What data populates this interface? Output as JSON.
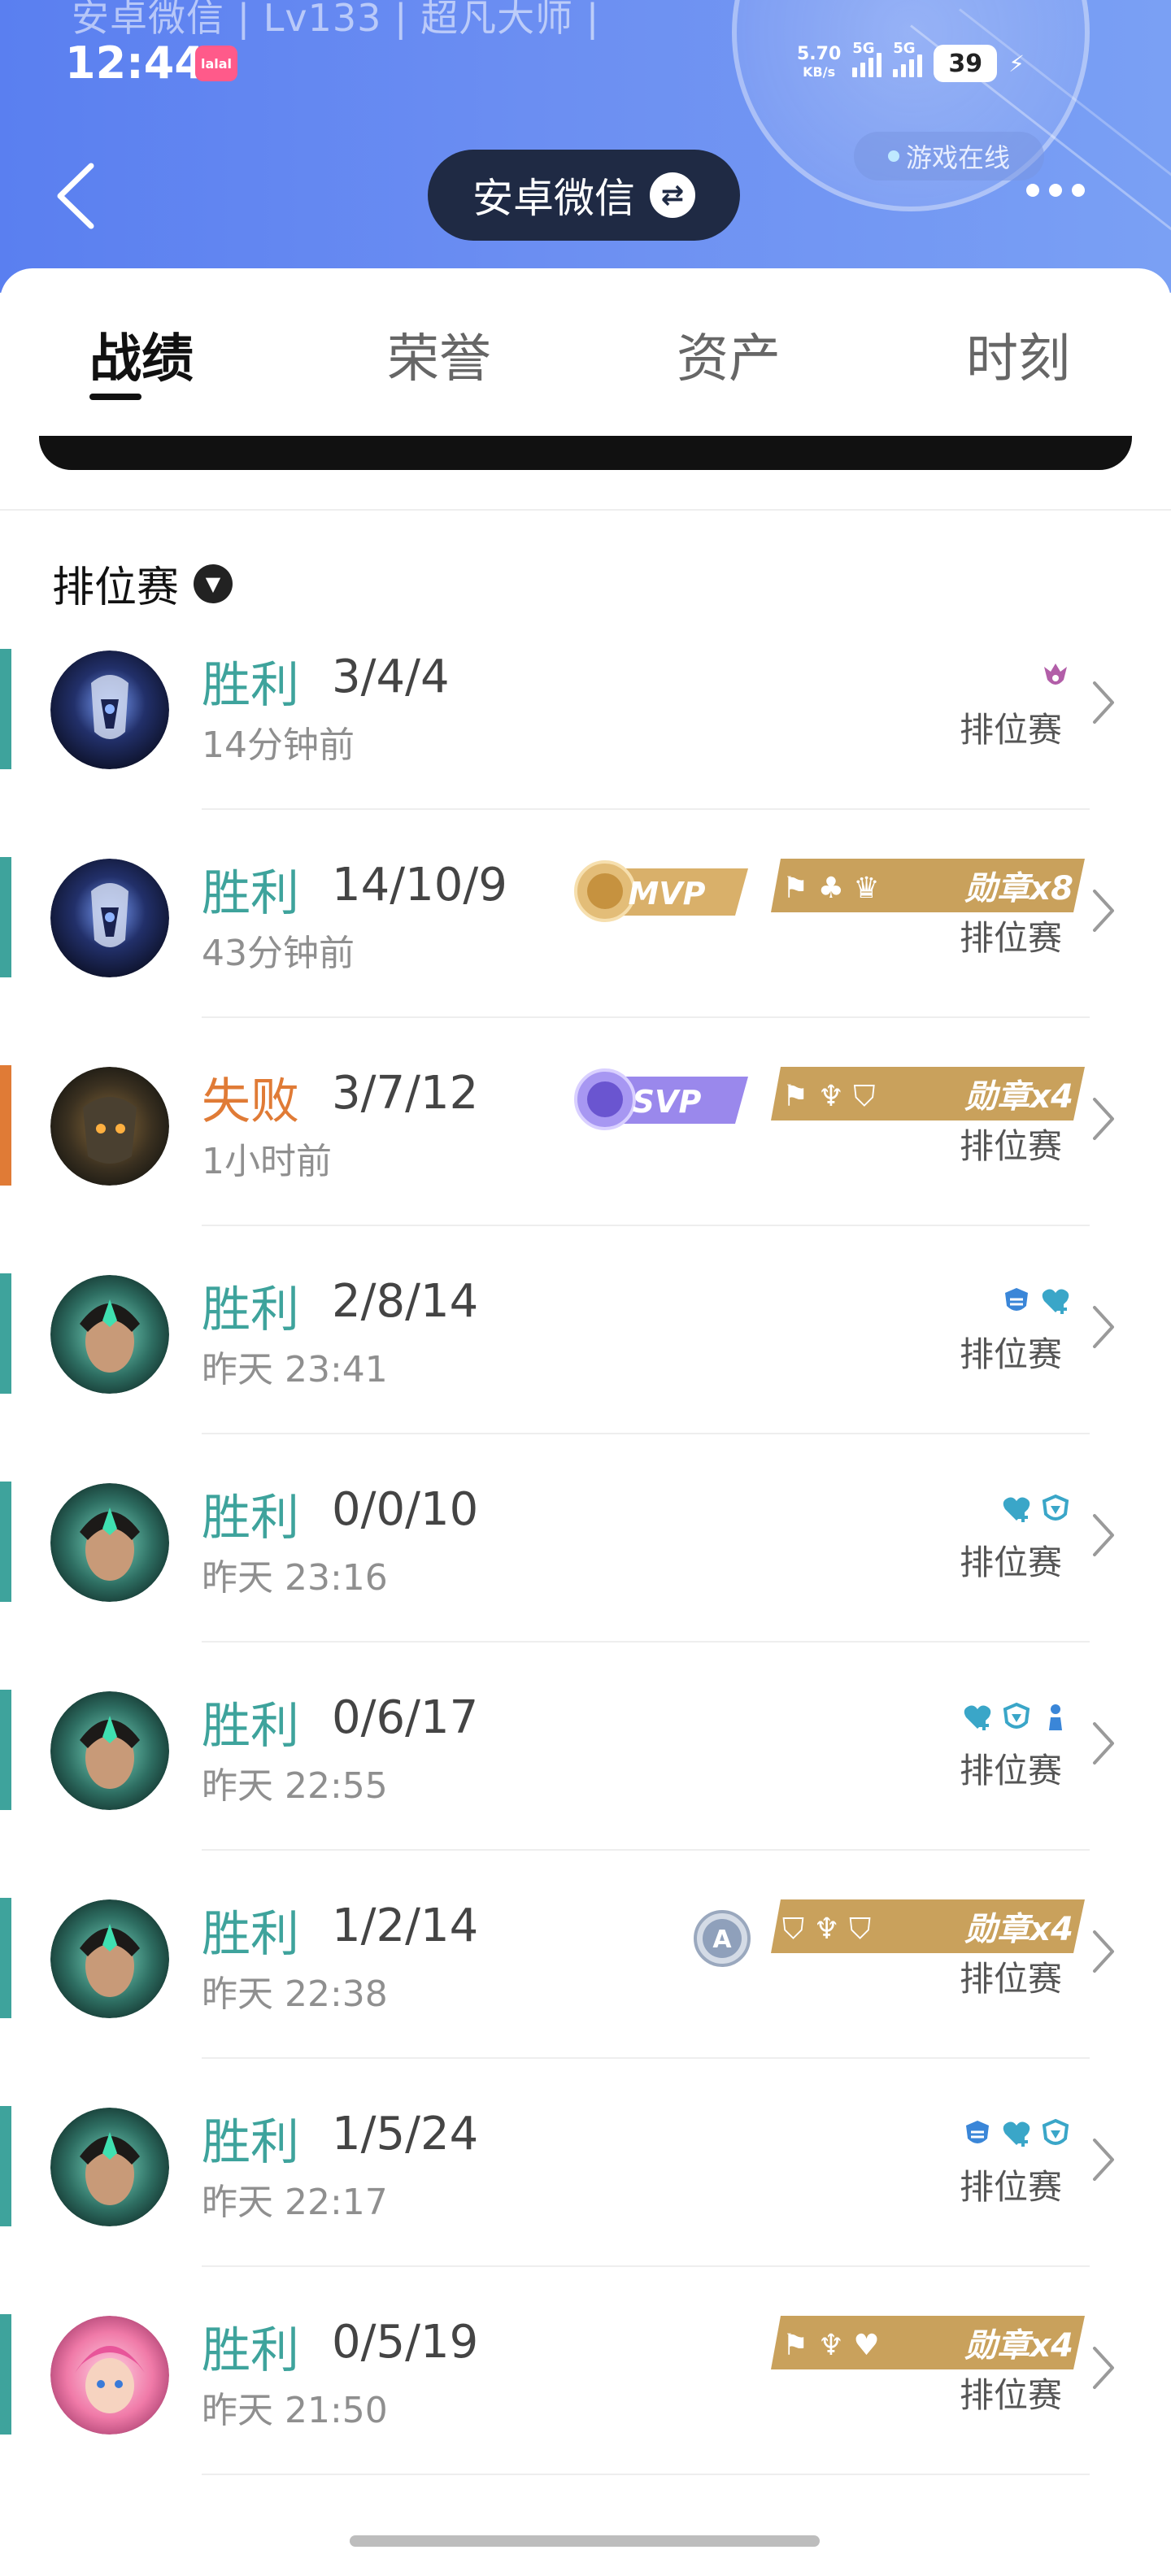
{
  "status_bar": {
    "profile_line": "安卓微信 | Lv133 | 超凡大师 |",
    "time": "12:44",
    "app_badge": "lalal",
    "net_speed_value": "5.70",
    "net_speed_unit": "KB/s",
    "signal_label_1": "5G",
    "signal_label_2": "5G",
    "battery": "39"
  },
  "header": {
    "online_status": "游戏在线",
    "account_name": "安卓微信",
    "swap_icon": "swap-icon",
    "back_icon": "back-chevron-icon",
    "more_icon": "more-dots-icon"
  },
  "tabs": [
    {
      "label": "战绩",
      "active": true
    },
    {
      "label": "荣誉",
      "active": false
    },
    {
      "label": "资产",
      "active": false
    },
    {
      "label": "时刻",
      "active": false
    }
  ],
  "filter": {
    "label": "排位赛",
    "icon": "chevron-down-circle-icon"
  },
  "colors": {
    "win": "#3ea39c",
    "loss": "#e07b36",
    "badge_gold": "#c9a15c",
    "svp_purple": "#8f7be8"
  },
  "matches": [
    {
      "result": "胜利",
      "kda": "3/4/4",
      "time": "14分钟前",
      "mode": "排位赛",
      "outcome": "win",
      "avatar": "dark-knight-avatar",
      "badges": {
        "mini_icons": [
          "purple-crest-icon"
        ]
      }
    },
    {
      "result": "胜利",
      "kda": "14/10/9",
      "time": "43分钟前",
      "mode": "排位赛",
      "outcome": "win",
      "avatar": "dark-knight-avatar",
      "badges": {
        "mvp": "MVP",
        "medal": "勋章x8"
      }
    },
    {
      "result": "失败",
      "kda": "3/7/12",
      "time": "1小时前",
      "mode": "排位赛",
      "outcome": "loss",
      "avatar": "armored-warrior-avatar",
      "badges": {
        "mvp": "SVP",
        "medal": "勋章x4"
      }
    },
    {
      "result": "胜利",
      "kda": "2/8/14",
      "time": "昨天 23:41",
      "mode": "排位赛",
      "outcome": "win",
      "avatar": "jade-hero-avatar",
      "badges": {
        "mini_icons": [
          "shield-swap-icon",
          "heart-plus-icon"
        ]
      }
    },
    {
      "result": "胜利",
      "kda": "0/0/10",
      "time": "昨天 23:16",
      "mode": "排位赛",
      "outcome": "win",
      "avatar": "jade-hero-avatar",
      "badges": {
        "mini_icons": [
          "heart-plus-icon",
          "shield-icon"
        ]
      }
    },
    {
      "result": "胜利",
      "kda": "0/6/17",
      "time": "昨天 22:55",
      "mode": "排位赛",
      "outcome": "win",
      "avatar": "jade-hero-avatar",
      "badges": {
        "mini_icons": [
          "heart-plus-icon",
          "shield-icon",
          "pawn-icon"
        ]
      }
    },
    {
      "result": "胜利",
      "kda": "1/2/14",
      "time": "昨天 22:38",
      "mode": "排位赛",
      "outcome": "win",
      "avatar": "jade-hero-avatar",
      "badges": {
        "a_badge": "A",
        "medal": "勋章x4"
      }
    },
    {
      "result": "胜利",
      "kda": "1/5/24",
      "time": "昨天 22:17",
      "mode": "排位赛",
      "outcome": "win",
      "avatar": "jade-hero-avatar",
      "badges": {
        "mini_icons": [
          "shield-swap-icon",
          "heart-plus-icon",
          "shield-icon"
        ]
      }
    },
    {
      "result": "胜利",
      "kda": "0/5/19",
      "time": "昨天 21:50",
      "mode": "排位赛",
      "outcome": "win",
      "avatar": "pink-hair-avatar",
      "badges": {
        "medal": "勋章x4"
      }
    }
  ]
}
